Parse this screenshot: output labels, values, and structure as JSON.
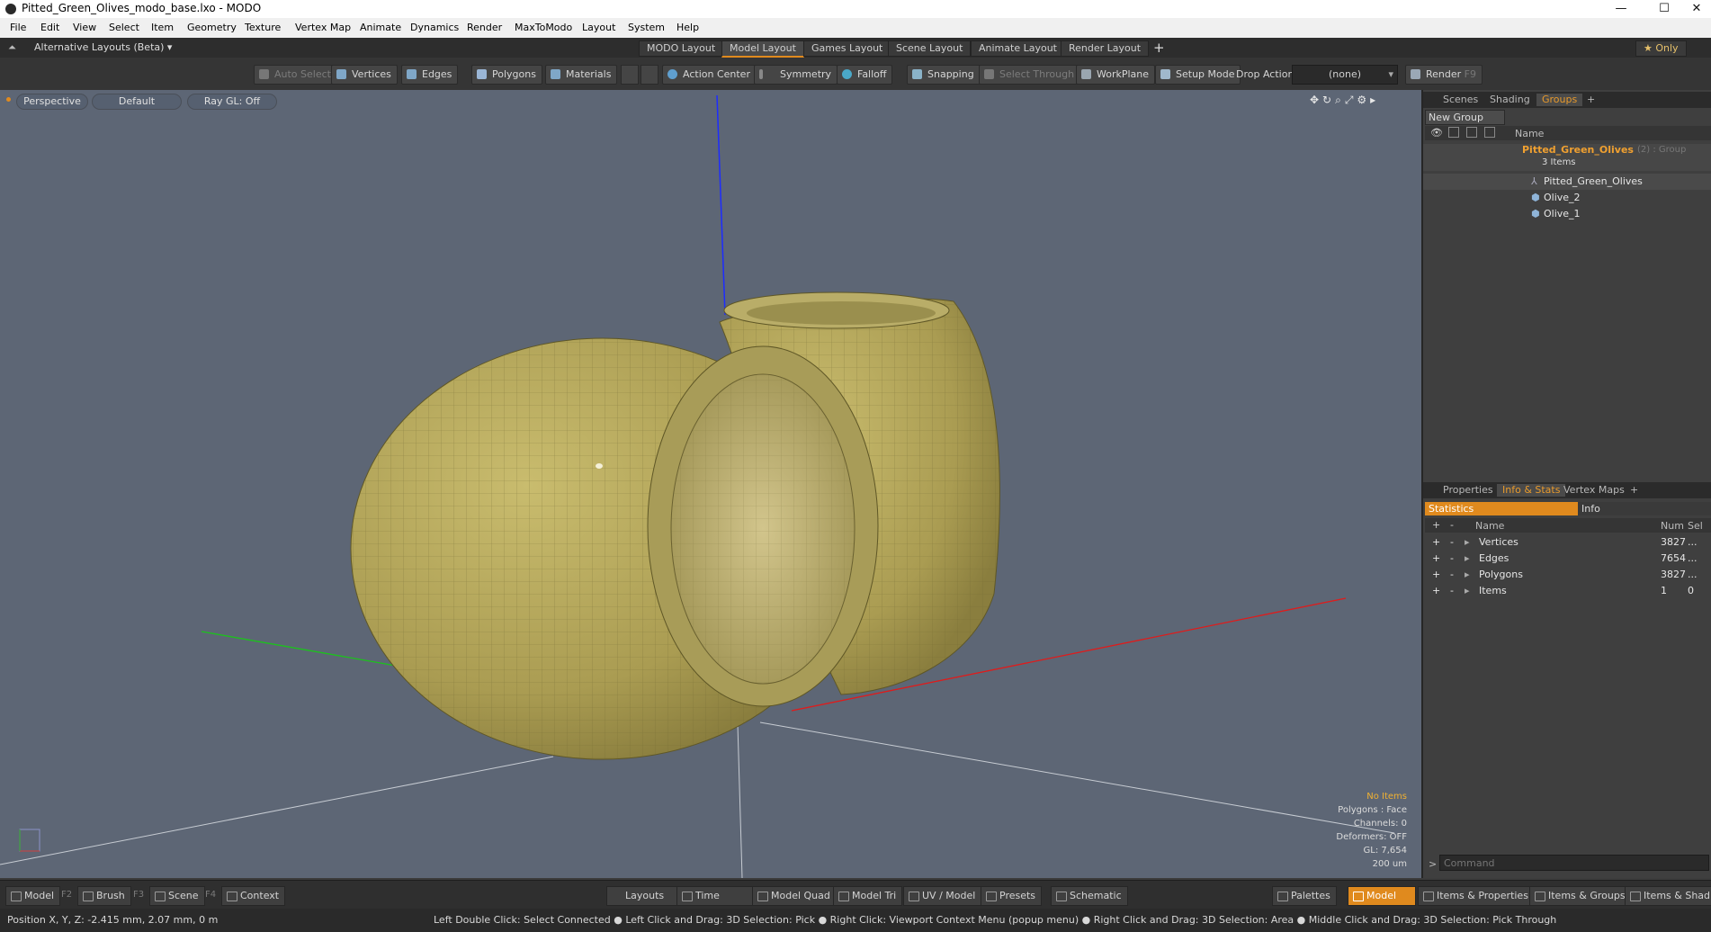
{
  "window": {
    "title": "Pitted_Green_Olives_modo_base.lxo - MODO",
    "minimize": "—",
    "maximize": "☐",
    "close": "✕"
  },
  "menu": [
    "File",
    "Edit",
    "View",
    "Select",
    "Item",
    "Geometry",
    "Texture",
    "Vertex Map",
    "Animate",
    "Dynamics",
    "Render",
    "MaxToModo",
    "Layout",
    "System",
    "Help"
  ],
  "layoutbar": {
    "layouts_menu": "Alternative Layouts (Beta) ▾",
    "tabs": [
      "MODO Layout",
      "Model Layout",
      "Games Layout",
      "Scene Layout",
      "Animate Layout",
      "Render Layout"
    ],
    "add": "+",
    "only": "★  Only"
  },
  "toolbar": {
    "auto_select": "Auto Select",
    "vertices": "Vertices",
    "edges": "Edges",
    "polygons": "Polygons",
    "materials": "Materials",
    "action_center": "Action Center",
    "symmetry": "Symmetry",
    "falloff": "Falloff",
    "snapping": "Snapping",
    "select_through": "Select Through",
    "workplane": "WorkPlane",
    "setup_mode": "Setup Mode",
    "drop_action_label": "Drop Action",
    "drop_action_value": "(none)",
    "render": "Render",
    "render_key": "F9"
  },
  "viewport": {
    "view": "Perspective",
    "shading": "Default",
    "raygl": "Ray GL: Off",
    "info": {
      "no_items": "No Items",
      "polygons": "Polygons : Face",
      "channels": "Channels: 0",
      "deformers": "Deformers: OFF",
      "gl": "GL: 7,654",
      "scale": "200 um"
    }
  },
  "scene_panel": {
    "tabs": [
      "Scenes",
      "Shading",
      "Groups"
    ],
    "add": "+",
    "new_group": "New Group",
    "column": "Name",
    "group_name": "Pitted_Green_Olives",
    "group_suffix": "(2) : Group",
    "item_count": "3 Items",
    "items": [
      "Pitted_Green_Olives",
      "Olive_2",
      "Olive_1"
    ]
  },
  "stats_panel": {
    "tabs": [
      "Properties",
      "Info & Stats",
      "Vertex Maps"
    ],
    "add": "+",
    "subtabs": [
      "Statistics",
      "Info"
    ],
    "columns": {
      "name": "Name",
      "num": "Num",
      "sel": "Sel"
    },
    "rows": [
      {
        "name": "Vertices",
        "num": "3827",
        "sel": "..."
      },
      {
        "name": "Edges",
        "num": "7654",
        "sel": "..."
      },
      {
        "name": "Polygons",
        "num": "3827",
        "sel": "..."
      },
      {
        "name": "Items",
        "num": "1",
        "sel": "0"
      }
    ]
  },
  "command": {
    "placeholder": "Command",
    "prompt": ">"
  },
  "bottombar": {
    "model": "Model",
    "model_key": "F2",
    "brush": "Brush",
    "brush_key": "F3",
    "scene": "Scene",
    "scene_key": "F4",
    "context": "Context",
    "layouts": "Layouts",
    "time": "Time",
    "model_quad": "Model Quad",
    "model_tri": "Model Tri",
    "uv_model": "UV / Model",
    "presets": "Presets",
    "schematic": "Schematic",
    "palettes": "Palettes",
    "model_active": "Model",
    "items_properties": "Items & Properties",
    "items_groups": "Items & Groups",
    "items_shading": "Items & Shadin"
  },
  "status": {
    "position": "Position X, Y, Z:   -2.415 mm, 2.07 mm, 0 m",
    "hints": "Left Double Click: Select Connected ● Left Click and Drag: 3D Selection: Pick ● Right Click: Viewport Context Menu (popup menu) ● Right Click and Drag: 3D Selection: Area ● Middle Click and Drag: 3D Selection: Pick Through"
  },
  "colors": {
    "accent": "#e08a1e",
    "olive": "#b7aa5c",
    "viewport_bg": "#5d6675"
  }
}
